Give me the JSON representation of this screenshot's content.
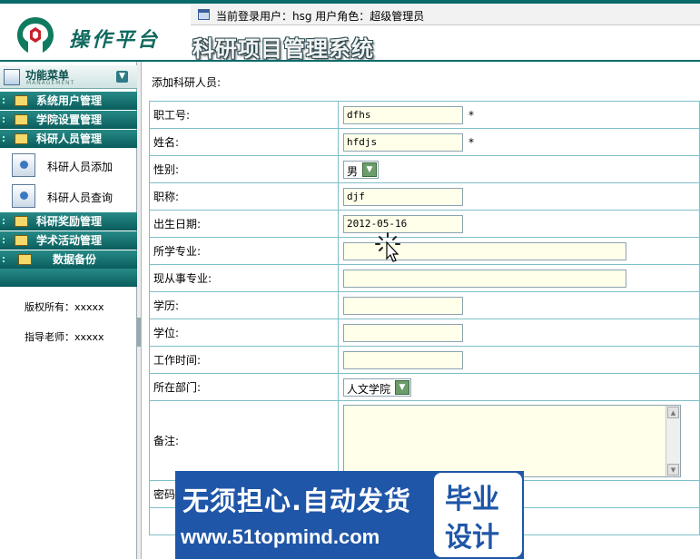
{
  "header": {
    "logo_text": "操作平台",
    "user_info": "当前登录用户：hsg  用户角色：超级管理员",
    "system_title": "科研项目管理系统"
  },
  "sidebar": {
    "menu_title": "功能菜单",
    "menu_subtitle": "MANAGEMENT",
    "groups": [
      {
        "label": "系统用户管理"
      },
      {
        "label": "学院设置管理"
      },
      {
        "label": "科研人员管理"
      },
      {
        "label": "科研奖励管理"
      },
      {
        "label": "学术活动管理"
      },
      {
        "label": "数据备份"
      }
    ],
    "sub_items": [
      {
        "label": "科研人员添加"
      },
      {
        "label": "科研人员查询"
      }
    ],
    "copyright": "版权所有：xxxxx",
    "teacher": "指导老师：xxxxx"
  },
  "form": {
    "title": "添加科研人员:",
    "fields": [
      {
        "label": "职工号:",
        "value": "dfhs",
        "required": "*"
      },
      {
        "label": "姓名:",
        "value": "hfdjs",
        "required": "*"
      },
      {
        "label": "性别:",
        "value": "男"
      },
      {
        "label": "职称:",
        "value": "djf"
      },
      {
        "label": "出生日期:",
        "value": "2012-05-16"
      },
      {
        "label": "所学专业:",
        "value": ""
      },
      {
        "label": "现从事专业:",
        "value": ""
      },
      {
        "label": "学历:",
        "value": ""
      },
      {
        "label": "学位:",
        "value": ""
      },
      {
        "label": "工作时间:",
        "value": ""
      },
      {
        "label": "所在部门:",
        "value": "人文学院"
      },
      {
        "label": "备注:",
        "value": ""
      },
      {
        "label": "密码",
        "value": ""
      }
    ]
  },
  "watermark": {
    "line1": "无须担心.自动发货",
    "line2": "www.51topmind.com",
    "badge1": "毕业",
    "badge2": "设计"
  },
  "colors": {
    "menu_bar": "#0a5d5d",
    "table_border": "#7fbfc8",
    "input_bg": "#ffffea",
    "watermark_bg": "#1f56a8"
  }
}
